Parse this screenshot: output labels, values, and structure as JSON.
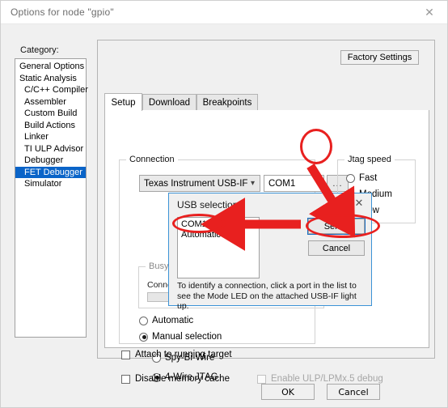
{
  "window": {
    "title": "Options for node \"gpio\"",
    "close_icon": "close-icon"
  },
  "category": {
    "label": "Category:",
    "items": [
      {
        "label": "General Options",
        "indent": false,
        "selected": false
      },
      {
        "label": "Static Analysis",
        "indent": false,
        "selected": false
      },
      {
        "label": "C/C++ Compiler",
        "indent": true,
        "selected": false
      },
      {
        "label": "Assembler",
        "indent": true,
        "selected": false
      },
      {
        "label": "Custom Build",
        "indent": true,
        "selected": false
      },
      {
        "label": "Build Actions",
        "indent": true,
        "selected": false
      },
      {
        "label": "Linker",
        "indent": true,
        "selected": false
      },
      {
        "label": "TI ULP Advisor",
        "indent": true,
        "selected": false
      },
      {
        "label": "Debugger",
        "indent": true,
        "selected": false
      },
      {
        "label": "FET Debugger",
        "indent": true,
        "selected": true
      },
      {
        "label": "Simulator",
        "indent": true,
        "selected": false
      }
    ],
    "selected_color": "#0a64c8"
  },
  "right_pane": {
    "factory_settings_label": "Factory Settings",
    "tabs": [
      {
        "label": "Setup",
        "active": true
      },
      {
        "label": "Download",
        "active": false
      },
      {
        "label": "Breakpoints",
        "active": false
      }
    ]
  },
  "connection": {
    "group_label": "Connection",
    "driver_value": "Texas Instrument USB-IF",
    "driver_caret_icon": "chevron-down-icon",
    "port_value": "COM1",
    "browse_label": "...",
    "busy": {
      "group_label": "Busy",
      "status_text": "Connection: Looking for connections...",
      "progress_percent": 0
    },
    "radios": [
      {
        "label": "Automatic",
        "selected": false,
        "indent": false
      },
      {
        "label": "Manual selection",
        "selected": true,
        "indent": false
      },
      {
        "label": "Spy-Bi-Wire",
        "selected": false,
        "indent": true
      },
      {
        "label": "4-Wire JTAG",
        "selected": true,
        "indent": true
      }
    ]
  },
  "jtag_speed": {
    "group_label": "Jtag speed",
    "options": [
      {
        "label": "Fast",
        "selected": false
      },
      {
        "label": "Medium",
        "selected": true
      },
      {
        "label": "Slow",
        "selected": false
      }
    ]
  },
  "checkboxes": [
    {
      "label": "Attach to running target",
      "checked": false,
      "disabled": false
    },
    {
      "label": "Disable memory cache",
      "checked": false,
      "disabled": false
    },
    {
      "label": "Enable ULP/LPMx.5 debug",
      "checked": false,
      "disabled": true
    }
  ],
  "footer": {
    "ok_label": "OK",
    "cancel_label": "Cancel"
  },
  "usb_dialog": {
    "title": "USB selection",
    "close_icon": "close-icon",
    "list_items": [
      {
        "label": "COM1"
      },
      {
        "label": "Automatic"
      }
    ],
    "select_label": "Select",
    "cancel_label": "Cancel",
    "help_text": "To identify a connection, click a port in the list to see the Mode LED on the attached USB-IF light up."
  },
  "annotations": {
    "color": "#e8201f",
    "shapes": [
      {
        "name": "ellipse-browse-button"
      },
      {
        "name": "ellipse-select-button"
      },
      {
        "name": "ellipse-com1-item"
      },
      {
        "name": "arrow-browse-to-select"
      },
      {
        "name": "arrow-select-to-com1"
      }
    ]
  }
}
